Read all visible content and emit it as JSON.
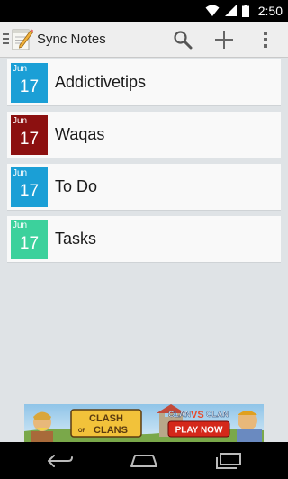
{
  "status_bar": {
    "time": "2:50",
    "icons": [
      "wifi-icon",
      "signal-icon",
      "battery-icon"
    ]
  },
  "action_bar": {
    "title": "Sync Notes",
    "actions": [
      "search-icon",
      "add-icon",
      "overflow-menu-icon"
    ]
  },
  "notes": [
    {
      "month": "Jun",
      "day": "17",
      "title": "Addictivetips",
      "color": "#1b9fd6"
    },
    {
      "month": "Jun",
      "day": "17",
      "title": "Waqas",
      "color": "#8c1010"
    },
    {
      "month": "Jun",
      "day": "17",
      "title": "To Do",
      "color": "#1b9fd6"
    },
    {
      "month": "Jun",
      "day": "17",
      "title": "Tasks",
      "color": "#3cd19c"
    }
  ],
  "ad": {
    "logo_line1": "CLASH",
    "logo_line2": "CLANS",
    "logo_of": "OF",
    "tagline_left": "CLAN",
    "tagline_vs": "VS",
    "tagline_right": "CLAN",
    "cta": "PLAY NOW"
  },
  "colors": {
    "background": "#dfe3e6",
    "action_bar": "#eeeeee",
    "card": "#f9f9f9"
  }
}
